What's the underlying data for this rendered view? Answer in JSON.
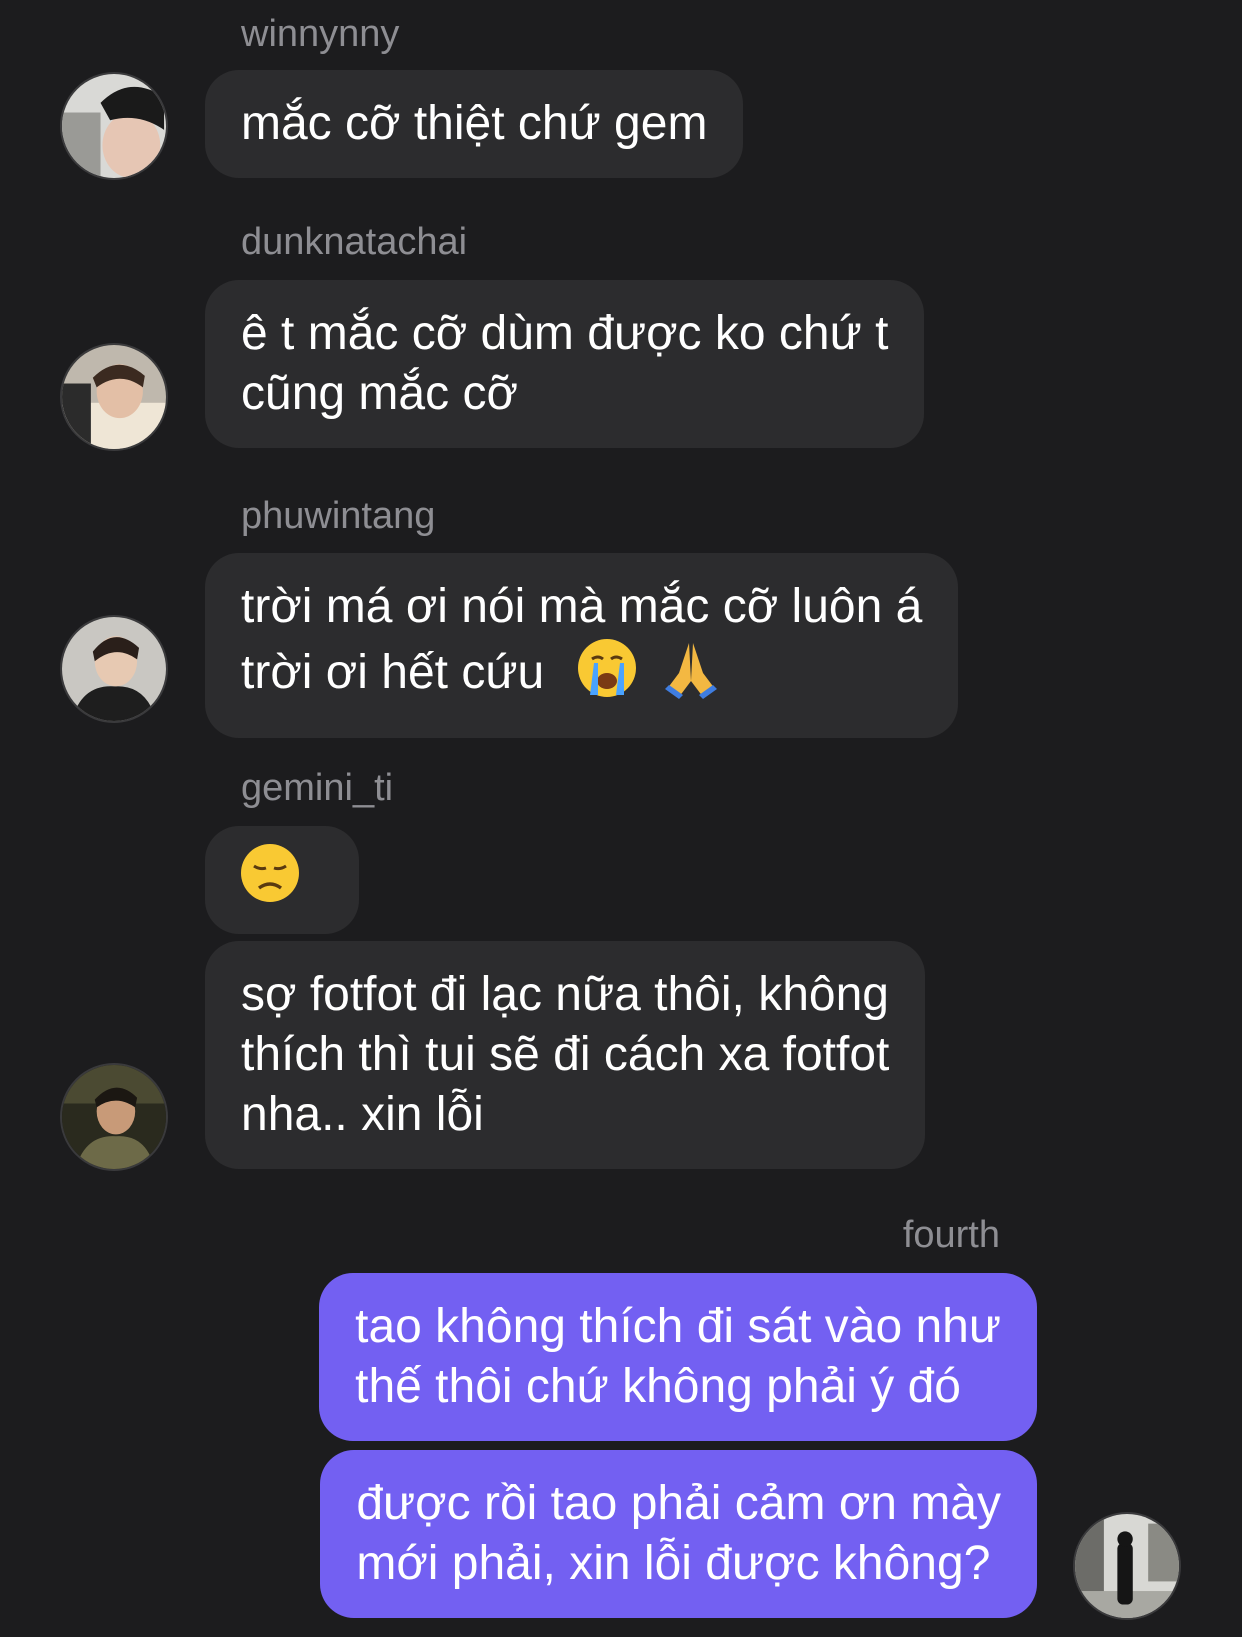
{
  "messages": [
    {
      "sender": "winnynny",
      "lines": [
        "mắc cỡ thiệt chứ gem"
      ]
    },
    {
      "sender": "dunknatachai",
      "lines": [
        "ê t mắc cỡ dùm được ko chứ t",
        "cũng mắc cỡ"
      ]
    },
    {
      "sender": "phuwintang",
      "lines": [
        "trời má ơi nói mà mắc cỡ luôn á",
        "trời ơi hết cứu"
      ],
      "emoji": [
        "loudly-crying-face",
        "folded-hands"
      ]
    },
    {
      "sender": "gemini_ti",
      "emoji": [
        "disappointed-face"
      ]
    },
    {
      "sender": "gemini_ti",
      "lines": [
        "sợ fotfot đi lạc nữa thôi, không",
        "thích thì tui sẽ đi cách xa fotfot",
        "nha.. xin lỗi"
      ]
    },
    {
      "sender": "fourth",
      "outgoing": true,
      "lines": [
        "tao không thích đi sát vào như",
        "thế thôi chứ không phải ý đó"
      ]
    },
    {
      "sender": "fourth",
      "outgoing": true,
      "lines": [
        "được rồi tao phải cảm ơn mày",
        "mới phải, xin lỗi được không?"
      ]
    }
  ],
  "colors": {
    "background": "#1c1c1e",
    "incoming_bubble": "#2c2c2e",
    "outgoing_bubble": "#7360f2",
    "username": "#8e8e93"
  }
}
